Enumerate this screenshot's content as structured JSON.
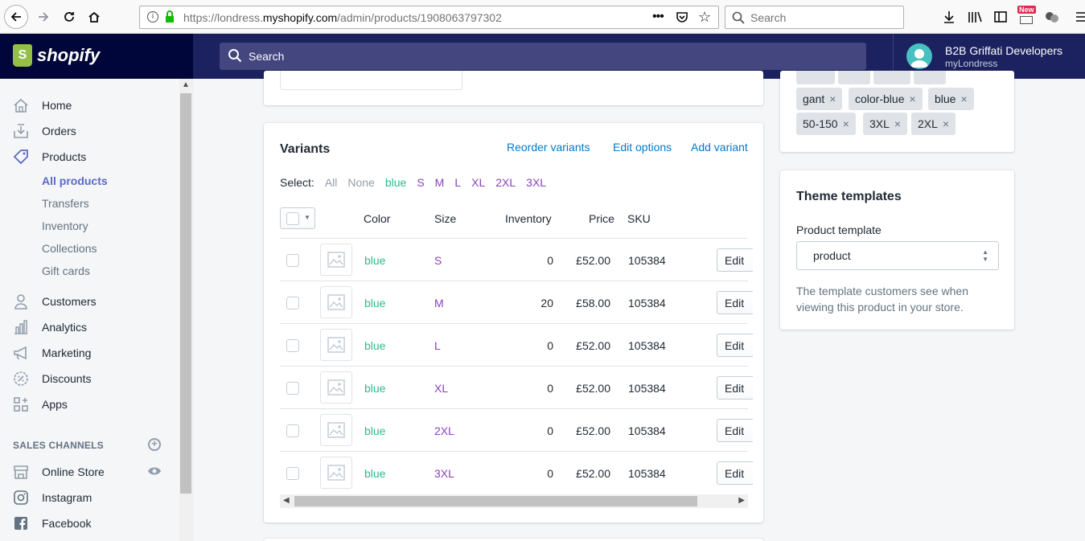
{
  "browser": {
    "url_prefix": "https://londress.",
    "url_domain": "myshopify.com",
    "url_path": "/admin/products/1908063797302",
    "search_placeholder": "Search",
    "new_badge": "New"
  },
  "header": {
    "logo_text": "shopify",
    "search_placeholder": "Search",
    "user_name": "B2B Griffati Developers",
    "store_name": "myLondress"
  },
  "sidebar": {
    "items": [
      {
        "label": "Home"
      },
      {
        "label": "Orders"
      },
      {
        "label": "Products"
      },
      {
        "label": "Customers"
      },
      {
        "label": "Analytics"
      },
      {
        "label": "Marketing"
      },
      {
        "label": "Discounts"
      },
      {
        "label": "Apps"
      }
    ],
    "product_sub": [
      "All products",
      "Transfers",
      "Inventory",
      "Collections",
      "Gift cards"
    ],
    "sales_channels_label": "SALES CHANNELS",
    "channels": [
      {
        "label": "Online Store"
      },
      {
        "label": "Instagram"
      },
      {
        "label": "Facebook"
      }
    ]
  },
  "variants": {
    "title": "Variants",
    "actions": [
      "Reorder variants",
      "Edit options",
      "Add variant"
    ],
    "select_label": "Select:",
    "select_options": [
      "All",
      "None",
      "blue",
      "S",
      "M",
      "L",
      "XL",
      "2XL",
      "3XL"
    ],
    "columns": [
      "Color",
      "Size",
      "Inventory",
      "Price",
      "SKU"
    ],
    "edit_label": "Edit",
    "rows": [
      {
        "color": "blue",
        "size": "S",
        "inventory": "0",
        "price": "£52.00",
        "sku": "105384"
      },
      {
        "color": "blue",
        "size": "M",
        "inventory": "20",
        "price": "£58.00",
        "sku": "105384"
      },
      {
        "color": "blue",
        "size": "L",
        "inventory": "0",
        "price": "£52.00",
        "sku": "105384"
      },
      {
        "color": "blue",
        "size": "XL",
        "inventory": "0",
        "price": "£52.00",
        "sku": "105384"
      },
      {
        "color": "blue",
        "size": "2XL",
        "inventory": "0",
        "price": "£52.00",
        "sku": "105384"
      },
      {
        "color": "blue",
        "size": "3XL",
        "inventory": "0",
        "price": "£52.00",
        "sku": "105384"
      }
    ]
  },
  "tags": [
    "gant",
    "color-blue",
    "blue",
    "50-150",
    "3XL",
    "2XL"
  ],
  "theme_templates": {
    "title": "Theme templates",
    "label": "Product template",
    "value": "product",
    "help": "The template customers see when viewing this product in your store."
  },
  "colors": {
    "accent": "#5c6ac4",
    "link": "#007ace",
    "nav_dark": "#1c2260",
    "green": "#2bbb8d",
    "purple": "#8a41c0"
  }
}
